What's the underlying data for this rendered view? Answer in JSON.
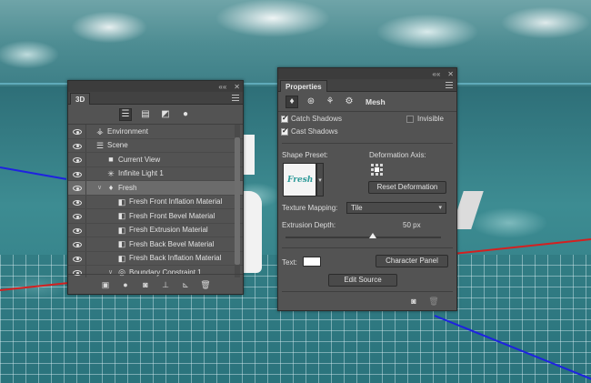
{
  "panel_3d": {
    "tab_label": "3D",
    "filter_icons": [
      "whole-scene-icon",
      "meshes-icon",
      "materials-icon",
      "lights-icon"
    ],
    "tree": [
      {
        "name": "row-environment",
        "label": "Environment",
        "icon": "environment-icon",
        "level": 0,
        "chevron": false,
        "selected": false
      },
      {
        "name": "row-scene",
        "label": "Scene",
        "icon": "scene-icon",
        "level": 0,
        "chevron": false,
        "selected": false
      },
      {
        "name": "row-current-view",
        "label": "Current View",
        "icon": "camera-icon",
        "level": 1,
        "chevron": false,
        "selected": false
      },
      {
        "name": "row-infinite-light",
        "label": "Infinite Light 1",
        "icon": "light-icon",
        "level": 1,
        "chevron": false,
        "selected": false
      },
      {
        "name": "row-fresh",
        "label": "Fresh",
        "icon": "mesh-icon",
        "level": 1,
        "chevron": true,
        "selected": true
      },
      {
        "name": "row-front-inflation",
        "label": "Fresh Front Inflation Material",
        "icon": "material-icon",
        "level": 2,
        "chevron": false,
        "selected": false
      },
      {
        "name": "row-front-bevel",
        "label": "Fresh Front Bevel Material",
        "icon": "material-icon",
        "level": 2,
        "chevron": false,
        "selected": false
      },
      {
        "name": "row-extrusion",
        "label": "Fresh Extrusion Material",
        "icon": "material-icon",
        "level": 2,
        "chevron": false,
        "selected": false
      },
      {
        "name": "row-back-bevel",
        "label": "Fresh Back Bevel Material",
        "icon": "material-icon",
        "level": 2,
        "chevron": false,
        "selected": false
      },
      {
        "name": "row-back-inflation",
        "label": "Fresh Back Inflation Material",
        "icon": "material-icon",
        "level": 2,
        "chevron": false,
        "selected": false
      },
      {
        "name": "row-boundary",
        "label": "Boundary Constraint 1",
        "icon": "constraint-icon",
        "level": 2,
        "chevron": true,
        "selected": false
      }
    ],
    "bottom_icons": [
      "add-mesh-icon",
      "add-light-icon",
      "render-icon",
      "ground-icon",
      "new-constraint-icon",
      "trash-icon"
    ]
  },
  "panel_props": {
    "tab_label": "Properties",
    "mode_label": "Mesh",
    "catch_shadows": {
      "label": "Catch Shadows",
      "checked": true
    },
    "cast_shadows": {
      "label": "Cast Shadows",
      "checked": true
    },
    "invisible": {
      "label": "Invisible",
      "checked": false
    },
    "shape_preset_label": "Shape Preset:",
    "shape_preset_thumb_text": "Fresh",
    "deformation_axis_label": "Deformation Axis:",
    "reset_deformation": "Reset Deformation",
    "texture_mapping_label": "Texture Mapping:",
    "texture_mapping_value": "Tile",
    "extrusion_depth_label": "Extrusion Depth:",
    "extrusion_depth_value": "50 px",
    "extrusion_slider_fraction": 0.5,
    "text_label": "Text:",
    "character_panel": "Character Panel",
    "edit_source": "Edit Source"
  }
}
